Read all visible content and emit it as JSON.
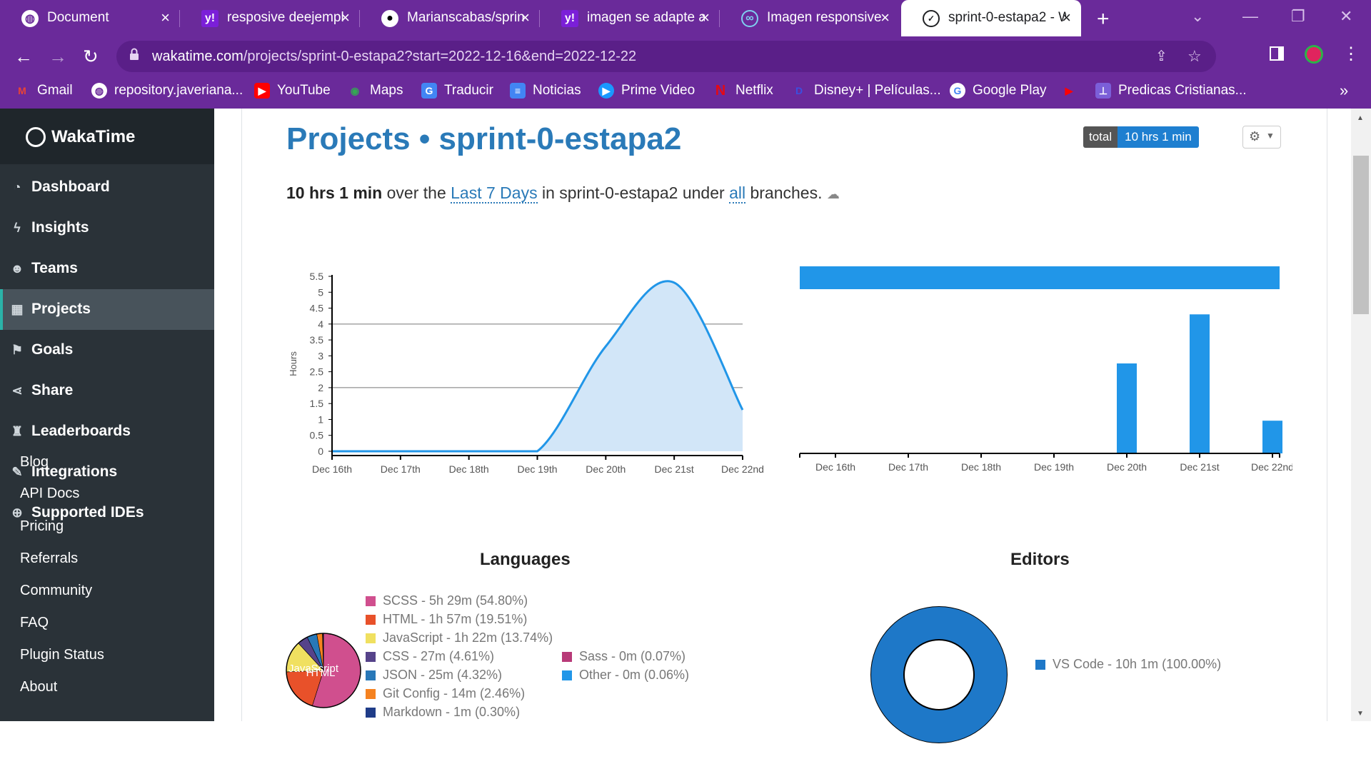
{
  "browser": {
    "tabs": [
      {
        "label": "Document",
        "icon": "globe-icon"
      },
      {
        "label": "resposive deejempl",
        "icon": "yahoo-icon"
      },
      {
        "label": "Marianscabas/sprin",
        "icon": "github-icon"
      },
      {
        "label": "imagen se adapte a",
        "icon": "yahoo-icon"
      },
      {
        "label": "Imagen responsive",
        "icon": "loop-icon"
      },
      {
        "label": "sprint-0-estapa2 - W",
        "icon": "wakatime-icon"
      }
    ],
    "url_host": "wakatime.com",
    "url_path": "/projects/sprint-0-estapa2?start=2022-12-16&end=2022-12-22",
    "bookmarks": [
      {
        "label": "Gmail",
        "icon": "gmail-icon"
      },
      {
        "label": "repository.javeriana...",
        "icon": "globe-icon"
      },
      {
        "label": "YouTube",
        "icon": "youtube-icon"
      },
      {
        "label": "Maps",
        "icon": "maps-icon"
      },
      {
        "label": "Traducir",
        "icon": "translate-icon"
      },
      {
        "label": "Noticias",
        "icon": "news-icon"
      },
      {
        "label": "Prime Video",
        "icon": "prime-video-icon"
      },
      {
        "label": "Netflix",
        "icon": "netflix-icon"
      },
      {
        "label": "Disney+ | Películas...",
        "icon": "disney-icon"
      },
      {
        "label": "Google Play",
        "icon": "google-icon"
      },
      {
        "label": "",
        "icon": "youtube-icon"
      },
      {
        "label": "Predicas Cristianas...",
        "icon": "bookmark-icon"
      }
    ],
    "bookmarks_more": "»"
  },
  "sidebar": {
    "brand": "WakaTime",
    "items": [
      {
        "label": "Dashboard",
        "icon": "dashboard-icon"
      },
      {
        "label": "Insights",
        "icon": "bolt-icon"
      },
      {
        "label": "Teams",
        "icon": "users-icon"
      },
      {
        "label": "Projects",
        "icon": "grid-icon"
      },
      {
        "label": "Goals",
        "icon": "flag-icon"
      },
      {
        "label": "Share",
        "icon": "share-icon"
      },
      {
        "label": "Leaderboards",
        "icon": "trophy-icon"
      },
      {
        "label": "Integrations",
        "icon": "wrench-icon"
      },
      {
        "label": "Supported IDEs",
        "icon": "plus-circle-icon"
      }
    ],
    "links": [
      "Blog",
      "API Docs",
      "Pricing",
      "Referrals",
      "Community",
      "FAQ",
      "Plugin Status",
      "About"
    ]
  },
  "page": {
    "title": "Projects • sprint-0-estapa2",
    "total_label": "total",
    "total_value": "10 hrs 1 min",
    "summary_time": "10 hrs 1 min",
    "summary_over": "over the",
    "summary_range": "Last 7 Days",
    "summary_in": "in sprint-0-estapa2 under",
    "summary_branch": "all",
    "summary_end": "branches.",
    "languages_title": "Languages",
    "editors_title": "Editors"
  },
  "colors": {
    "accent": "#2196e8",
    "title": "#2a7ab8",
    "sidebar": "#2a3238",
    "browser": "#6a2a9a"
  },
  "chart_data": [
    {
      "type": "area",
      "categories": [
        "Dec 16th",
        "Dec 17th",
        "Dec 18th",
        "Dec 19th",
        "Dec 20th",
        "Dec 21st",
        "Dec 22nd"
      ],
      "values": [
        0,
        0,
        0,
        0,
        3.3,
        5.3,
        1.3
      ],
      "ylabel": "Hours",
      "yticks": [
        "0",
        "0.5",
        "1",
        "1.5",
        "2",
        "2.5",
        "3",
        "3.5",
        "4",
        "4.5",
        "5",
        "5.5"
      ],
      "ylim": [
        0,
        5.5
      ],
      "grid": true
    },
    {
      "type": "bar",
      "categories": [
        "Dec 16th",
        "Dec 17th",
        "Dec 18th",
        "Dec 19th",
        "Dec 20th",
        "Dec 21st",
        "Dec 22nd"
      ],
      "values": [
        0,
        0,
        0,
        0,
        3.3,
        5.1,
        1.2
      ],
      "ylim": [
        0,
        5.5
      ]
    },
    {
      "type": "pie",
      "title": "Languages",
      "series": [
        {
          "name": "SCSS",
          "label": "SCSS - 5h 29m (54.80%)",
          "value": 54.8,
          "color": "#d04f8e"
        },
        {
          "name": "HTML",
          "label": "HTML - 1h 57m (19.51%)",
          "value": 19.51,
          "color": "#e8512a"
        },
        {
          "name": "JavaScript",
          "label": "JavaScript - 1h 22m (13.74%)",
          "value": 13.74,
          "color": "#f0e060"
        },
        {
          "name": "CSS",
          "label": "CSS - 27m (4.61%)",
          "value": 4.61,
          "color": "#56438a"
        },
        {
          "name": "JSON",
          "label": "JSON - 25m (4.32%)",
          "value": 4.32,
          "color": "#2878b8"
        },
        {
          "name": "Git Config",
          "label": "Git Config - 14m (2.46%)",
          "value": 2.46,
          "color": "#f58220"
        },
        {
          "name": "Markdown",
          "label": "Markdown - 1m (0.30%)",
          "value": 0.3,
          "color": "#1f3c88"
        },
        {
          "name": "Sass",
          "label": "Sass - 0m (0.07%)",
          "value": 0.07,
          "color": "#b83a78"
        },
        {
          "name": "Other",
          "label": "Other - 0m (0.06%)",
          "value": 0.06,
          "color": "#2196e8"
        }
      ],
      "slice_labels": [
        "JavaScript",
        "HTML"
      ]
    },
    {
      "type": "pie",
      "title": "Editors",
      "series": [
        {
          "name": "VS Code",
          "label": "VS Code - 10h 1m (100.00%)",
          "value": 100.0,
          "color": "#1e78c8"
        }
      ]
    }
  ]
}
